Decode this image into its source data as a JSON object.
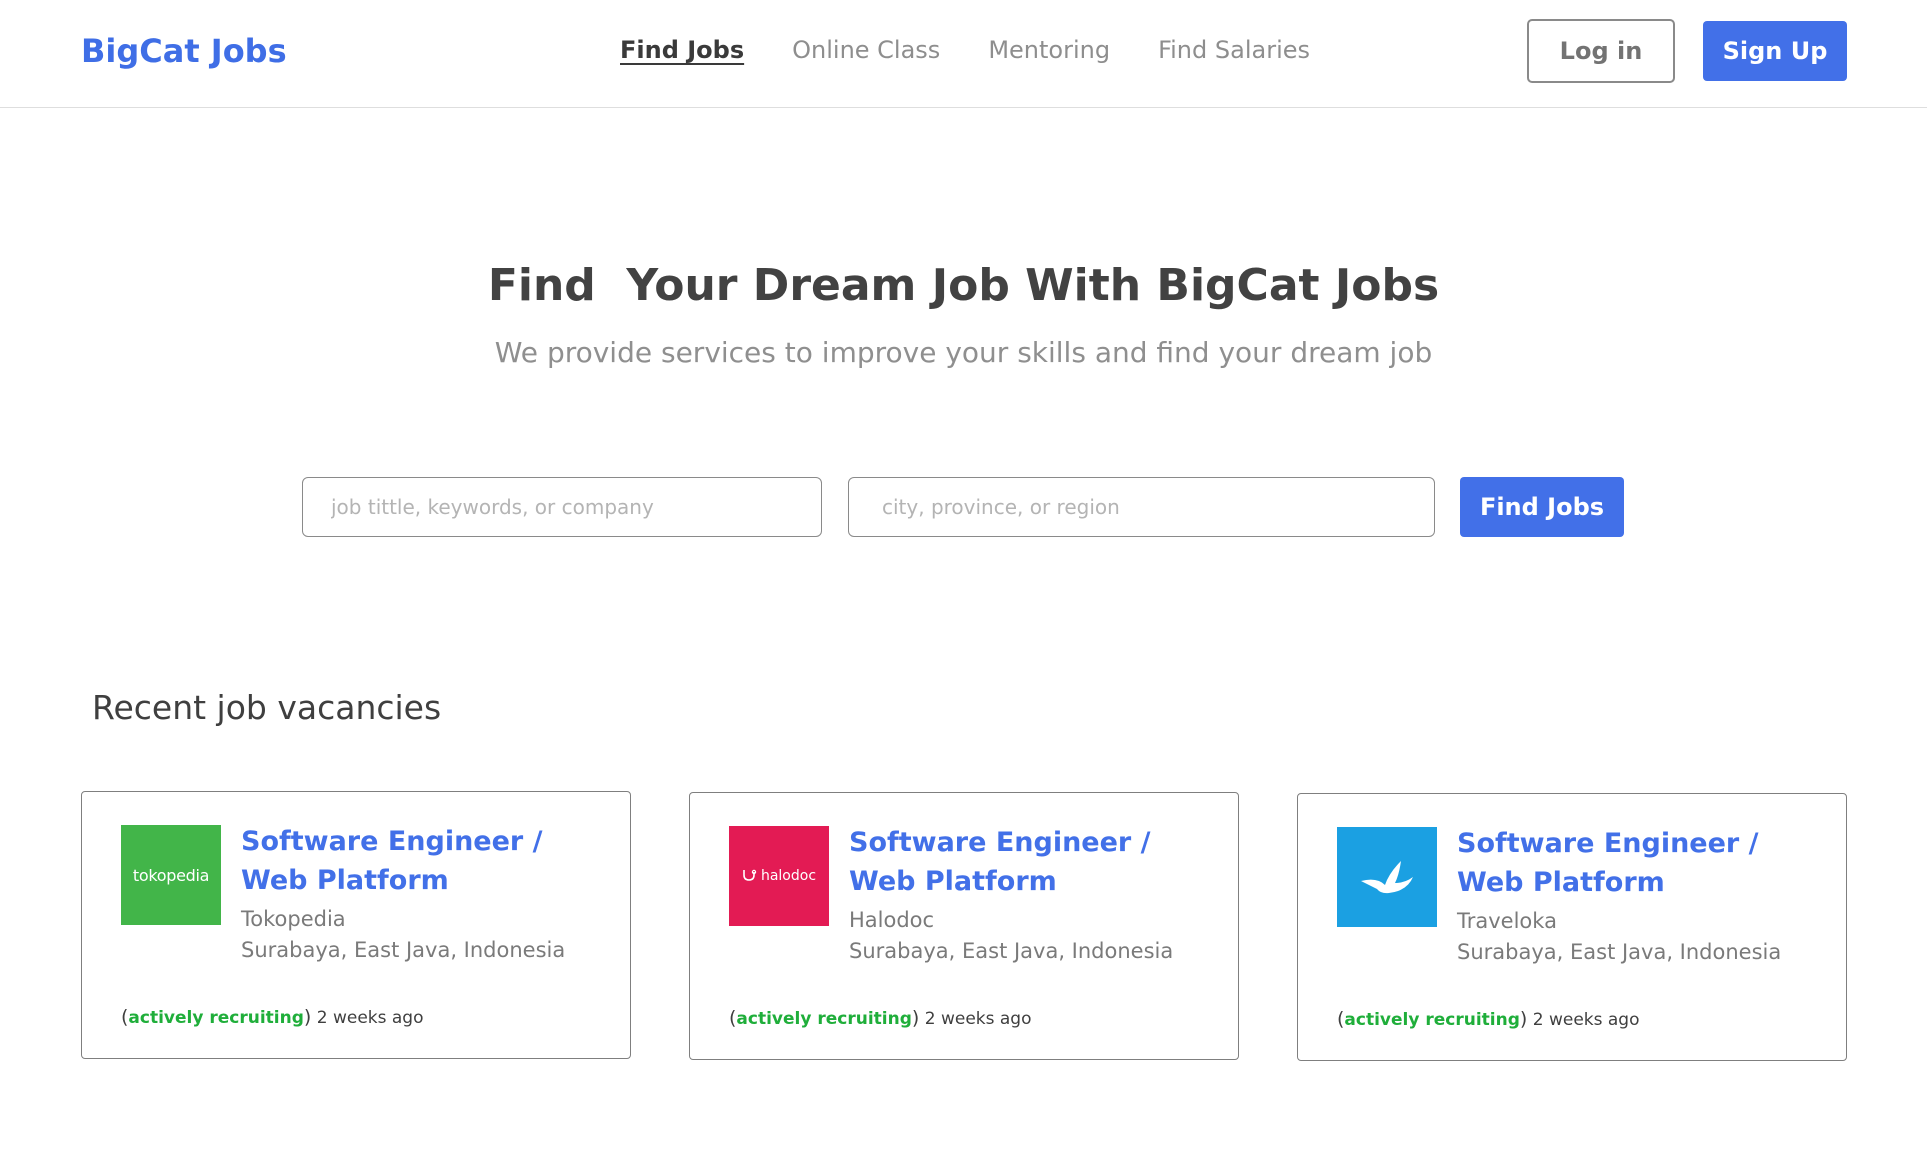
{
  "header": {
    "logo": "BigCat Jobs",
    "nav": [
      {
        "label": "Find Jobs",
        "active": true
      },
      {
        "label": "Online Class",
        "active": false
      },
      {
        "label": "Mentoring",
        "active": false
      },
      {
        "label": "Find Salaries",
        "active": false
      }
    ],
    "login_label": "Log in",
    "signup_label": "Sign Up"
  },
  "hero": {
    "title": "Find  Your Dream Job With BigCat Jobs",
    "subtitle": "We provide services to improve your skills and find your dream job"
  },
  "search": {
    "job_placeholder": "job tittle, keywords, or company",
    "location_placeholder": "city, province, or region",
    "button_label": "Find Jobs"
  },
  "recent": {
    "title": "Recent job vacancies",
    "jobs": [
      {
        "title": "Software Engineer / Web Platform",
        "company": "Tokopedia",
        "location": "Surabaya, East Java, Indonesia",
        "status": "actively recruiting",
        "posted": "2 weeks ago",
        "logo_text": "tokopedia",
        "logo_color": "#42b549"
      },
      {
        "title": "Software Engineer / Web Platform",
        "company": "Halodoc",
        "location": "Surabaya, East Java, Indonesia",
        "status": "actively recruiting",
        "posted": "2 weeks ago",
        "logo_text": "halodoc",
        "logo_color": "#e31b54"
      },
      {
        "title": "Software Engineer / Web Platform",
        "company": "Traveloka",
        "location": "Surabaya, East Java, Indonesia",
        "status": "actively recruiting",
        "posted": "2 weeks ago",
        "logo_text": "",
        "logo_color": "#1ba0e2"
      }
    ]
  },
  "colors": {
    "brand": "#4270e8",
    "recruiting": "#1fae3a"
  }
}
